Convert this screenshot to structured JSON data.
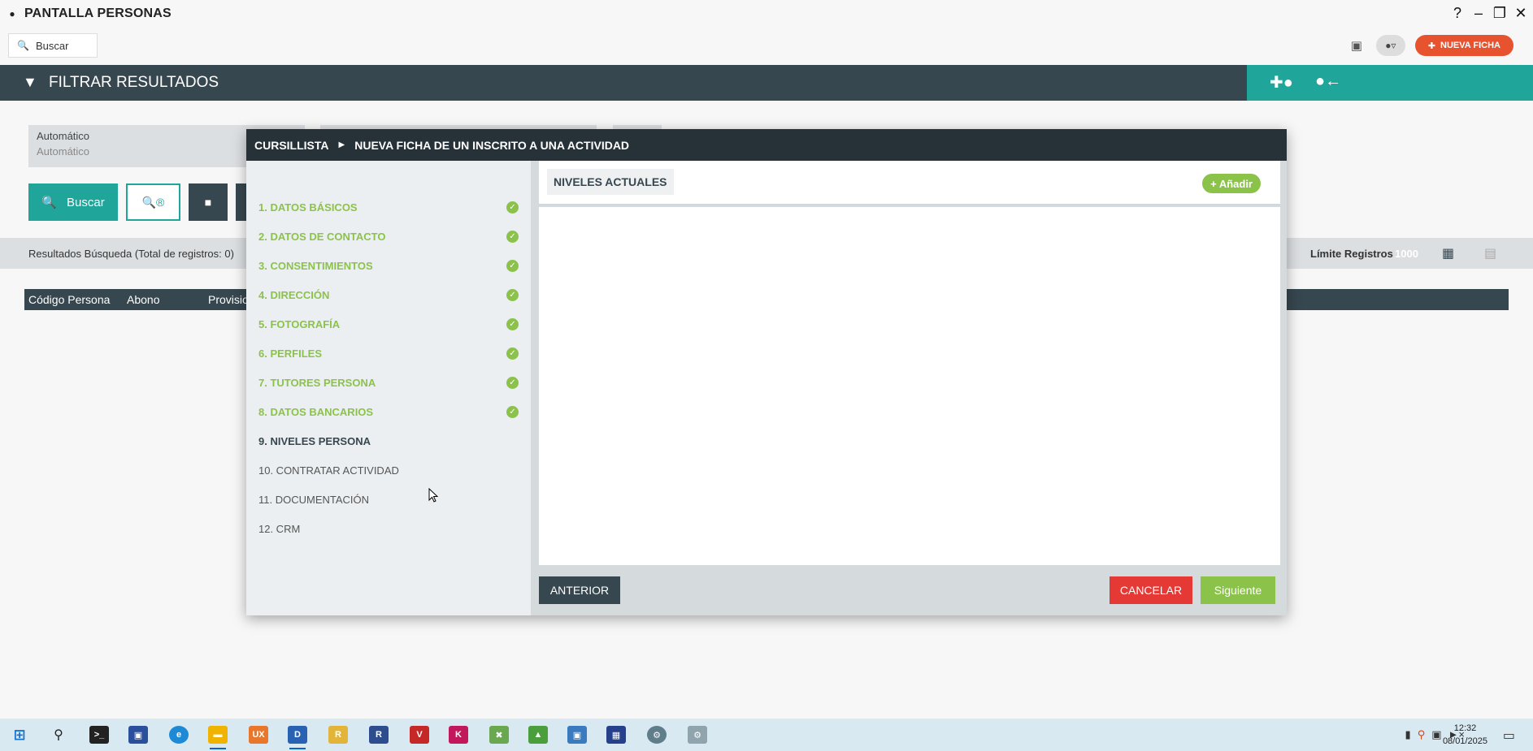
{
  "window": {
    "title": "PANTALLA PERSONAS",
    "help_label": "?",
    "controls": [
      "–",
      "❐",
      "✕"
    ]
  },
  "toolbar": {
    "search_label": "Buscar",
    "new_button_label": "NUEVA FICHA"
  },
  "filter_bar": {
    "title": "FILTRAR RESULTADOS"
  },
  "background_form": {
    "field_label": "Automático",
    "field_value": "Automático",
    "search_button": "Buscar",
    "results_text": "Resultados Búsqueda (Total de registros: 0)",
    "limit_label": "Límite Registros",
    "limit_value": "1000",
    "table_columns": [
      "Código Persona",
      "Abono",
      "Provisio"
    ]
  },
  "modal": {
    "breadcrumb_root": "CURSILLISTA",
    "breadcrumb_current": "NUEVA FICHA DE UN INSCRITO A UNA ACTIVIDAD",
    "steps": [
      {
        "label": "1. DATOS BÁSICOS",
        "status": "done"
      },
      {
        "label": "2. DATOS DE CONTACTO",
        "status": "done"
      },
      {
        "label": "3. CONSENTIMIENTOS",
        "status": "done"
      },
      {
        "label": "4. DIRECCIÓN",
        "status": "done"
      },
      {
        "label": "5. FOTOGRAFÍA",
        "status": "done"
      },
      {
        "label": "6. PERFILES",
        "status": "done"
      },
      {
        "label": "7. TUTORES PERSONA",
        "status": "done"
      },
      {
        "label": "8. DATOS BANCARIOS",
        "status": "done"
      },
      {
        "label": "9. NIVELES PERSONA",
        "status": "active"
      },
      {
        "label": "10. CONTRATAR ACTIVIDAD",
        "status": "todo"
      },
      {
        "label": "11. DOCUMENTACIÓN",
        "status": "todo"
      },
      {
        "label": "12. CRM",
        "status": "todo"
      }
    ],
    "section_title": "NIVELES ACTUALES",
    "add_button": "+ Añadir",
    "prev_button": "ANTERIOR",
    "cancel_button": "CANCELAR",
    "next_button": "Siguiente"
  },
  "taskbar": {
    "time": "12:32",
    "date": "08/01/2025"
  },
  "colors": {
    "dark": "#37474f",
    "teal": "#1fa59a",
    "green": "#8bc34a",
    "red": "#e53935",
    "orange": "#e8532f"
  }
}
